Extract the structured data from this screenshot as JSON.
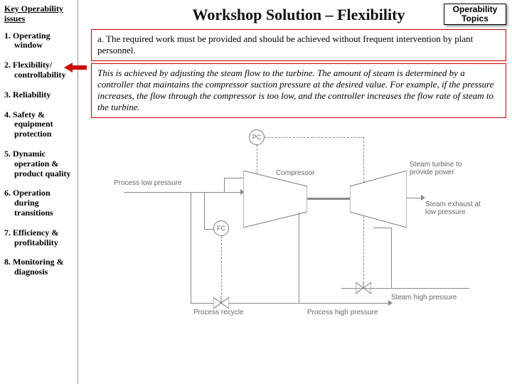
{
  "sidebar": {
    "title": "Key Operability issues",
    "items": [
      {
        "num": "1.",
        "l1": "Operating",
        "l2": "window"
      },
      {
        "num": "2.",
        "l1": "Flexibility/",
        "l2": "controllability"
      },
      {
        "num": "3.",
        "l1": "Reliability",
        "l2": ""
      },
      {
        "num": "4.",
        "l1": "Safety &",
        "l2": "equipment protection"
      },
      {
        "num": "5.",
        "l1": "Dynamic",
        "l2": "operation & product quality"
      },
      {
        "num": "6.",
        "l1": "Operation",
        "l2": "during transitions"
      },
      {
        "num": "7.",
        "l1": "Efficiency &",
        "l2": "profitability"
      },
      {
        "num": "8.",
        "l1": "Monitoring &",
        "l2": "diagnosis"
      }
    ]
  },
  "header": {
    "title": "Workshop Solution – Flexibility",
    "topics_btn": "Operability Topics"
  },
  "box1": "a.  The required work must be provided and should be achieved without frequent intervention by plant personnel.",
  "box2": "This is achieved by adjusting the steam flow to the turbine.  The amount of steam is determined by a controller that maintains the compressor suction pressure at the desired value.  For example, if the pressure increases, the flow through the compressor is too low, and the controller increases the flow rate of steam to the turbine.",
  "diagram": {
    "pc": "PC",
    "fc": "FC",
    "proc_low": "Process low pressure",
    "proc_high": "Process high pressure",
    "proc_recycle": "Process recycle",
    "compressor": "Compressor",
    "turbine": "Steam turbine to provide power",
    "exhaust": "Steam exhaust at low pressure",
    "steam_high": "Steam high pressure"
  }
}
